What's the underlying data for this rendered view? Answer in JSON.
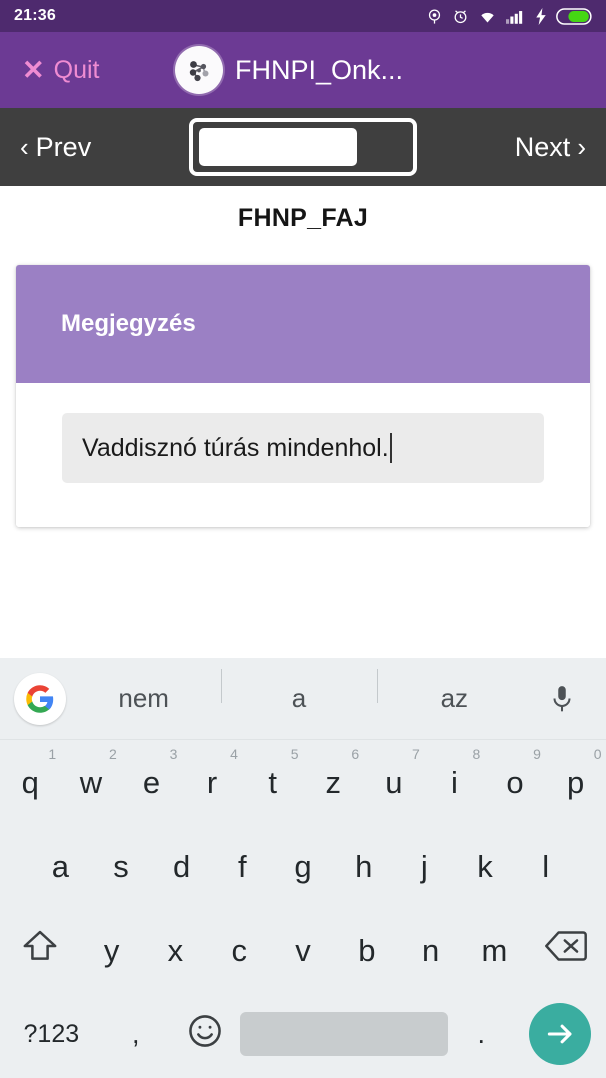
{
  "statusbar": {
    "time": "21:36",
    "icons": [
      "location-icon",
      "alarm-icon",
      "wifi-icon",
      "signal-icon",
      "charging-icon",
      "battery-icon"
    ]
  },
  "appbar": {
    "quit_label": "Quit",
    "quit_x": "✕",
    "title": "FHNPI_Onk...",
    "app_icon": "kobo-molecule-icon",
    "bg_color": "#6c3a94",
    "quit_color": "#ef8cd2"
  },
  "navbar": {
    "prev_label": "Prev",
    "next_label": "Next",
    "prev_chevron": "‹",
    "next_chevron": "›",
    "progress_percent": 76,
    "bg_color": "#3f3f3f"
  },
  "content": {
    "form_title": "FHNP_FAJ",
    "card": {
      "header_label": "Megjegyzés",
      "header_color": "#9b80c4",
      "input_value": "Vaddisznó túrás mindenhol.",
      "input_placeholder": ""
    }
  },
  "keyboard": {
    "google_icon": "google-logo-icon",
    "mic_icon": "microphone-icon",
    "suggestions": [
      "nem",
      "a",
      "az"
    ],
    "row1": [
      {
        "letter": "q",
        "num": "1"
      },
      {
        "letter": "w",
        "num": "2"
      },
      {
        "letter": "e",
        "num": "3"
      },
      {
        "letter": "r",
        "num": "4"
      },
      {
        "letter": "t",
        "num": "5"
      },
      {
        "letter": "z",
        "num": "6"
      },
      {
        "letter": "u",
        "num": "7"
      },
      {
        "letter": "i",
        "num": "8"
      },
      {
        "letter": "o",
        "num": "9"
      },
      {
        "letter": "p",
        "num": "0"
      }
    ],
    "row2": [
      "a",
      "s",
      "d",
      "f",
      "g",
      "h",
      "j",
      "k",
      "l"
    ],
    "row3": [
      "y",
      "x",
      "c",
      "v",
      "b",
      "n",
      "m"
    ],
    "shift_icon": "shift-up-arrow-icon",
    "backspace_icon": "backspace-delete-icon",
    "symbols_label": "?123",
    "comma_label": ",",
    "emoji_icon": "emoji-smiley-icon",
    "space_label": "",
    "period_label": ".",
    "enter_icon": "enter-arrow-icon",
    "enter_color": "#3aada0",
    "bg_color": "#eceff1"
  }
}
